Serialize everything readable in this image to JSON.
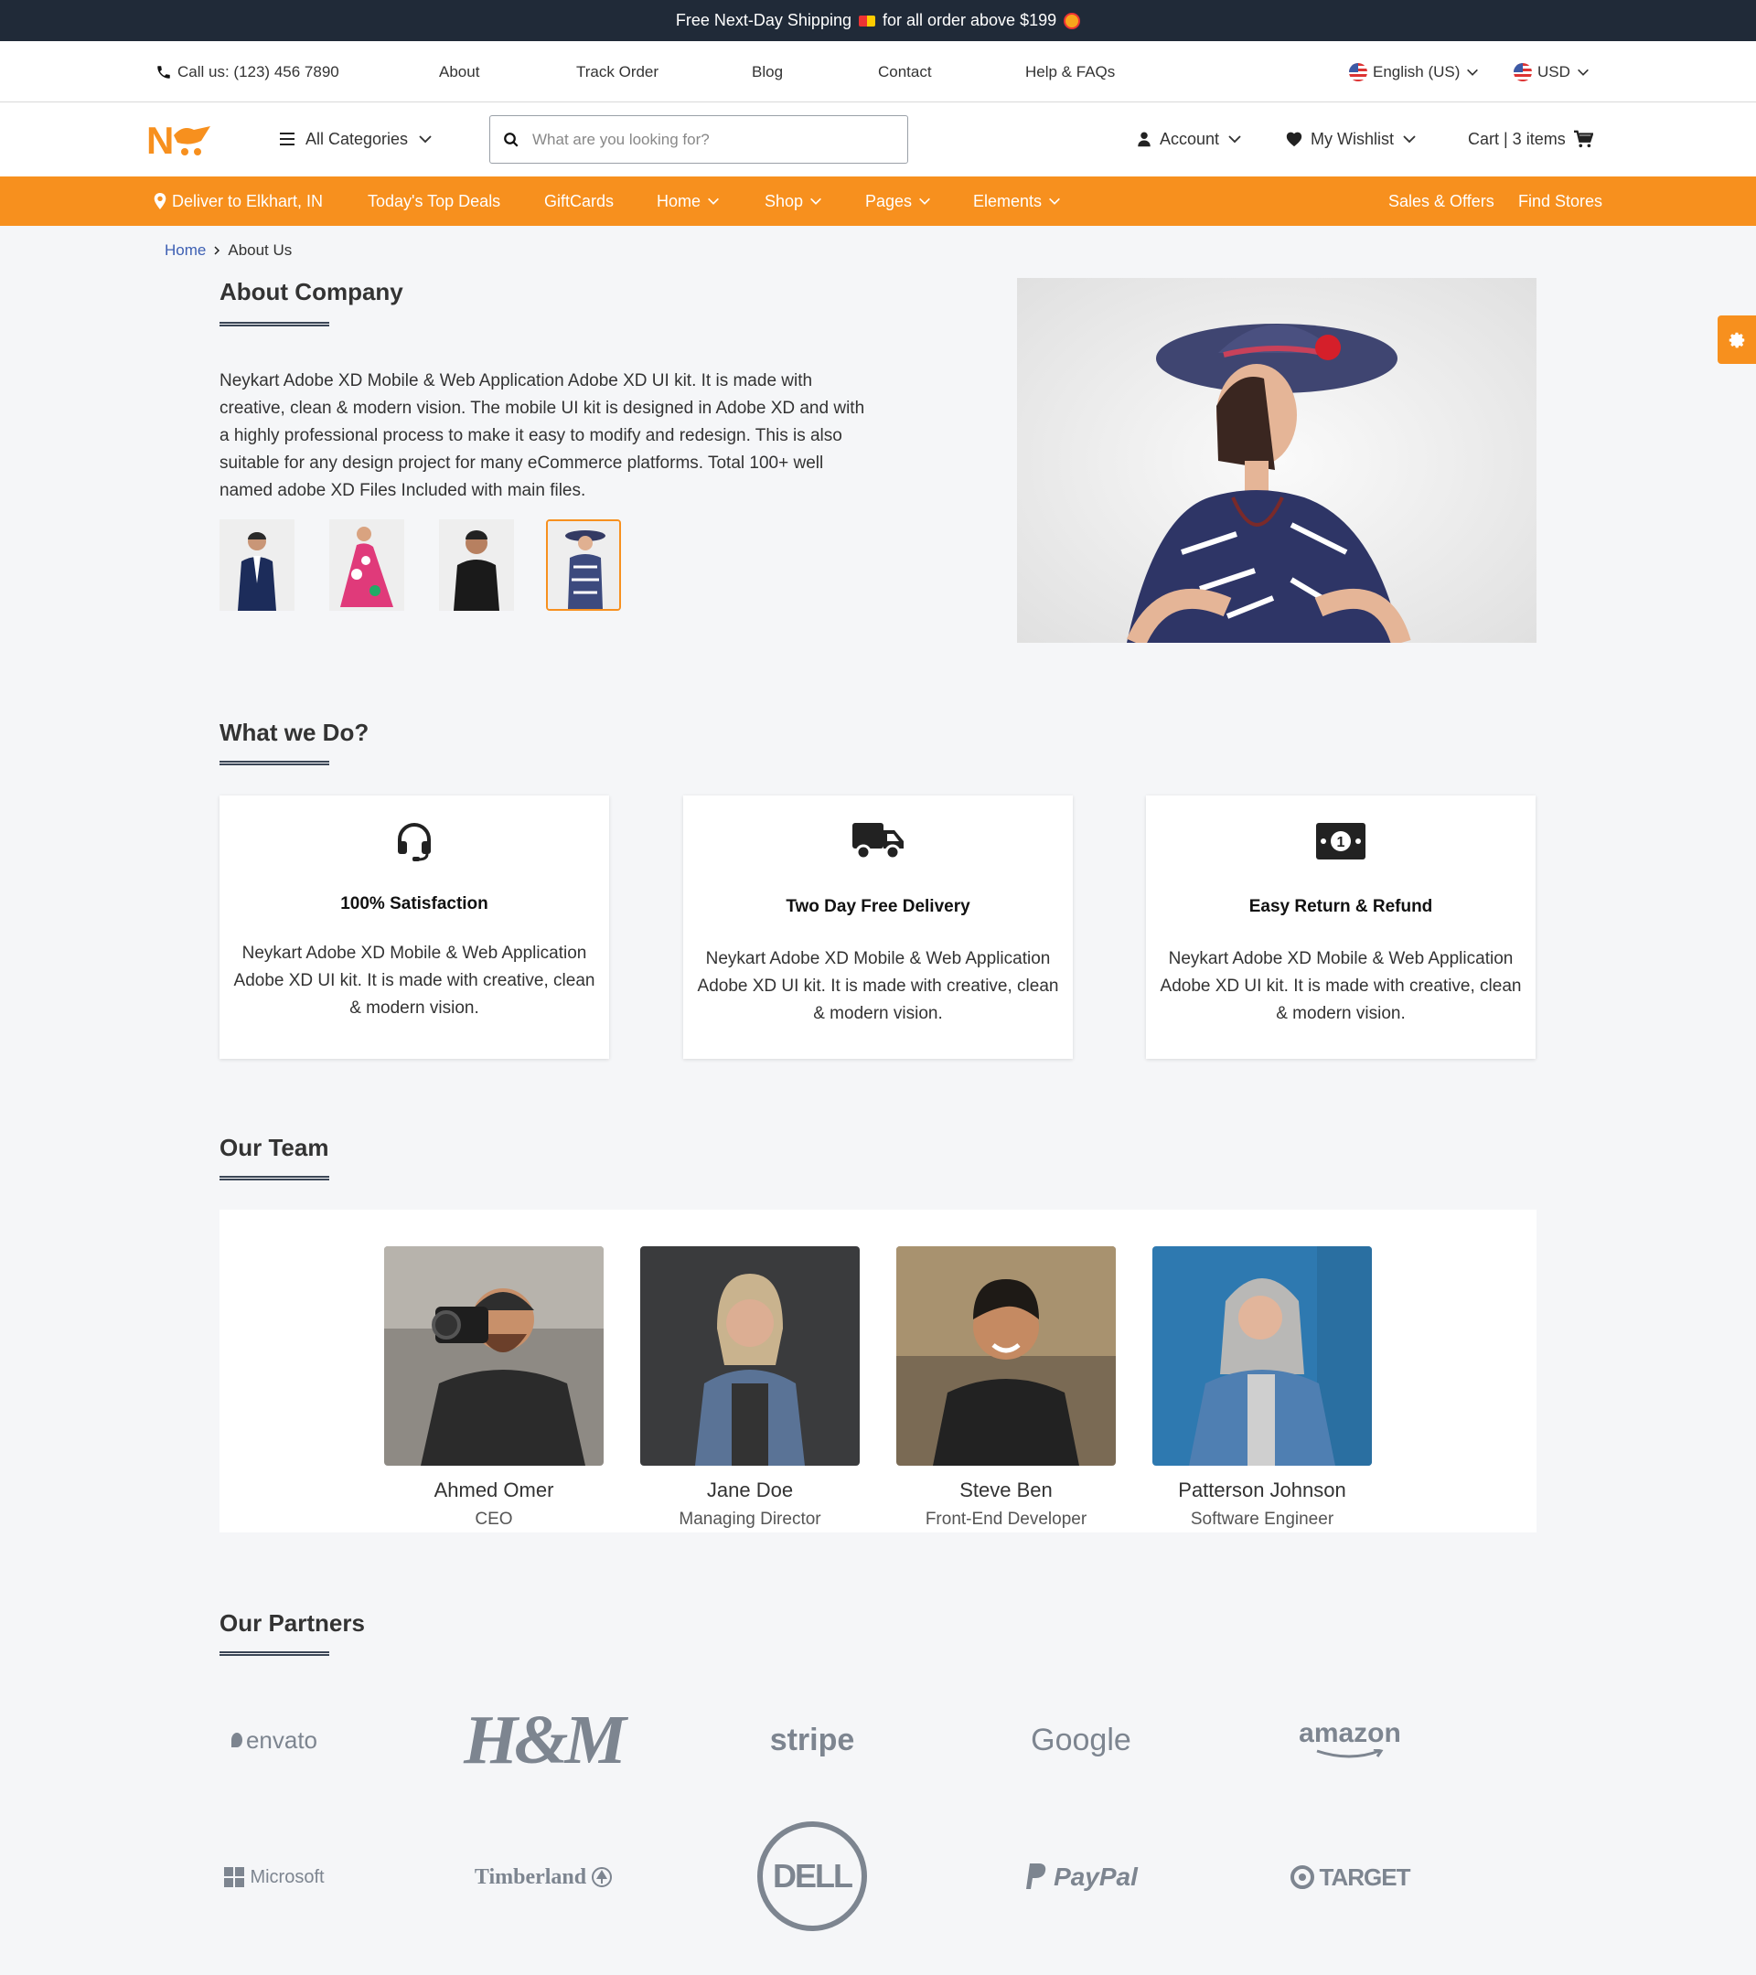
{
  "promo": {
    "text_before": "Free Next-Day Shipping",
    "text_after": "for all order above $199"
  },
  "util": {
    "phone": "Call us: (123) 456 7890",
    "links": [
      "About",
      "Track Order",
      "Blog",
      "Contact",
      "Help & FAQs"
    ],
    "language": "English (US)",
    "currency": "USD"
  },
  "header": {
    "all_categories": "All Categories",
    "search_placeholder": "What are you looking for?",
    "account": "Account",
    "wishlist": "My Wishlist",
    "cart": "Cart | 3 items"
  },
  "nav": {
    "deliver": "Deliver to Elkhart, IN",
    "items": [
      "Today's Top Deals",
      "GiftCards",
      "Home",
      "Shop",
      "Pages",
      "Elements"
    ],
    "right": [
      "Sales & Offers",
      "Find Stores"
    ]
  },
  "breadcrumb": {
    "home": "Home",
    "current": "About Us"
  },
  "about": {
    "title": "About Company",
    "paragraph": "Neykart Adobe XD Mobile & Web Application Adobe XD UI kit. It is made with creative, clean & modern vision. The mobile UI kit is designed in Adobe XD and with a highly professional process to make it easy to modify and redesign. This is also suitable for any design project for many eCommerce platforms. Total 100+ well named adobe XD Files Included with main files."
  },
  "what": {
    "title": "What we Do?",
    "cards": [
      {
        "icon": "headset-icon",
        "title": "100% Satisfaction",
        "desc": "Neykart Adobe XD Mobile & Web Application Adobe XD UI kit. It is made with creative, clean & modern vision."
      },
      {
        "icon": "truck-icon",
        "title": "Two Day Free Delivery",
        "desc": "Neykart Adobe XD Mobile & Web Application Adobe XD UI kit. It is made with creative, clean & modern vision."
      },
      {
        "icon": "money-icon",
        "title": "Easy Return & Refund",
        "desc": "Neykart Adobe XD Mobile & Web Application Adobe XD UI kit. It is made with creative, clean & modern vision."
      }
    ]
  },
  "team": {
    "title": "Our Team",
    "members": [
      {
        "name": "Ahmed Omer",
        "role": "CEO"
      },
      {
        "name": "Jane Doe",
        "role": "Managing Director"
      },
      {
        "name": "Steve Ben",
        "role": "Front-End Developer"
      },
      {
        "name": "Patterson Johnson",
        "role": "Software Engineer"
      }
    ]
  },
  "partners": {
    "title": "Our Partners",
    "logos": [
      "envato",
      "H&M",
      "stripe",
      "Google",
      "amazon",
      "Microsoft",
      "Timberland",
      "DELL",
      "PayPal",
      "TARGET"
    ]
  },
  "colors": {
    "accent": "#f7901e",
    "dark": "#202a38",
    "link": "#3d5fb3"
  }
}
